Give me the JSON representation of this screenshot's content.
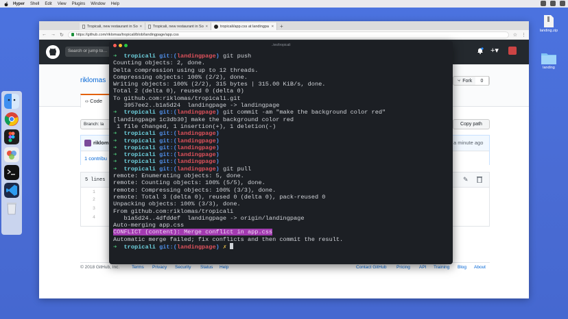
{
  "menubar": {
    "app": "Hyper",
    "items": [
      "Shell",
      "Edit",
      "View",
      "Plugins",
      "Window",
      "Help"
    ]
  },
  "desktop_files": [
    {
      "label": "landing.zip"
    },
    {
      "label": "landing"
    }
  ],
  "browser": {
    "tabs": [
      {
        "label": "Tropicali, new restaurant in So"
      },
      {
        "label": "Tropicali, new restaurant in So"
      },
      {
        "label": "tropicali/app.css at landingpa"
      }
    ],
    "url": "https://github.com/riklomas/tropicali/blob/landingpage/app.css"
  },
  "github": {
    "search_placeholder": "Search or jump to…",
    "owner": "riklomas",
    "fork_label": "Fork",
    "fork_count": "0",
    "code_tab": "Code",
    "branch_label": "Branch: la",
    "copy_path": "Copy path",
    "commit_user": "riklom",
    "commit_time": "a minute ago",
    "contributors": "1 contribu",
    "file_lines": "5 lines",
    "line_numbers": [
      "1",
      "2",
      "3",
      "4"
    ],
    "footer": {
      "copyright": "© 2018 GitHub, Inc.",
      "left_links": [
        "Terms",
        "Privacy",
        "Security",
        "Status",
        "Help"
      ],
      "right_links": [
        "Contact GitHub",
        "Pricing",
        "API",
        "Training",
        "Blog",
        "About"
      ]
    }
  },
  "terminal": {
    "title": "..tes/tropicali",
    "prompt": {
      "dir": "tropicali",
      "git": "git:(",
      "branch": "landingpage",
      "close": ")"
    },
    "lines": [
      {
        "type": "prompt",
        "cmd": " git push"
      },
      {
        "type": "out",
        "text": "Counting objects: 2, done."
      },
      {
        "type": "out",
        "text": "Delta compression using up to 12 threads."
      },
      {
        "type": "out",
        "text": "Compressing objects: 100% (2/2), done."
      },
      {
        "type": "out",
        "text": "Writing objects: 100% (2/2), 315 bytes | 315.00 KiB/s, done."
      },
      {
        "type": "out",
        "text": "Total 2 (delta 0), reused 0 (delta 0)"
      },
      {
        "type": "out",
        "text": "To github.com:riklomas/tropicali.git"
      },
      {
        "type": "out",
        "text": "   3957ee2..b1a5d24  landingpage -> landingpage"
      },
      {
        "type": "prompt",
        "cmd": " git commit -am \"make the background color red\""
      },
      {
        "type": "out",
        "text": "[landingpage 1c3db30] make the background color red"
      },
      {
        "type": "out",
        "text": " 1 file changed, 1 insertion(+), 1 deletion(-)"
      },
      {
        "type": "prompt",
        "cmd": ""
      },
      {
        "type": "prompt",
        "cmd": ""
      },
      {
        "type": "prompt",
        "cmd": ""
      },
      {
        "type": "prompt",
        "cmd": ""
      },
      {
        "type": "prompt",
        "cmd": ""
      },
      {
        "type": "prompt",
        "cmd": " git pull"
      },
      {
        "type": "out",
        "text": "remote: Enumerating objects: 5, done."
      },
      {
        "type": "out",
        "text": "remote: Counting objects: 100% (5/5), done."
      },
      {
        "type": "out",
        "text": "remote: Compressing objects: 100% (3/3), done."
      },
      {
        "type": "out",
        "text": "remote: Total 3 (delta 0), reused 0 (delta 0), pack-reused 0"
      },
      {
        "type": "out",
        "text": "Unpacking objects: 100% (3/3), done."
      },
      {
        "type": "out",
        "text": "From github.com:riklomas/tropicali"
      },
      {
        "type": "out",
        "text": "   b1a5d24..4dfddef  landingpage -> origin/landingpage"
      },
      {
        "type": "out",
        "text": "Auto-merging app.css"
      },
      {
        "type": "conflict",
        "text": "CONFLICT (content): Merge conflict in app.css"
      },
      {
        "type": "out",
        "text": "Automatic merge failed; fix conflicts and then commit the result."
      },
      {
        "type": "final",
        "cmd": " ✗ "
      }
    ]
  },
  "colors": {
    "desktop": "#4a6fd6",
    "terminal_bg": "#1c1f24",
    "prompt_arrow": "#4ec77a",
    "prompt_dir": "#6fd3e0",
    "prompt_git": "#4f8ee8",
    "prompt_branch": "#e0525c",
    "conflict_highlight": "#a23bb0",
    "github_header": "#24292e"
  }
}
